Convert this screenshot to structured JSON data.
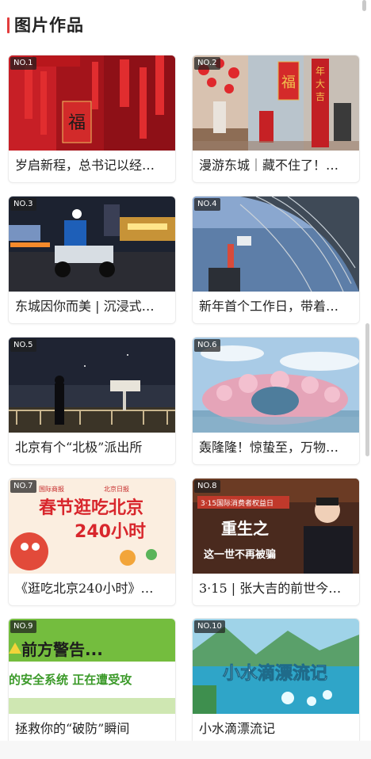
{
  "header": {
    "title": "图片作品"
  },
  "cards": [
    {
      "no": "NO.1",
      "caption": "岁启新程，总书记以经…"
    },
    {
      "no": "NO.2",
      "caption": "漫游东城｜藏不住了！…",
      "image_text": [
        "福",
        "年",
        "大",
        "吉"
      ]
    },
    {
      "no": "NO.3",
      "caption": "东城因你而美 | 沉浸式…"
    },
    {
      "no": "NO.4",
      "caption": "新年首个工作日，带着…"
    },
    {
      "no": "NO.5",
      "caption": "北京有个“北极”派出所"
    },
    {
      "no": "NO.6",
      "caption": "轰隆隆！惊蛰至，万物…"
    },
    {
      "no": "NO.7",
      "caption": "《逛吃北京240小时》…",
      "image_text": [
        "国际商报",
        "北京日报",
        "春节逛吃北京",
        "240小时"
      ]
    },
    {
      "no": "NO.8",
      "caption": "3·15 | 张大吉的前世今…",
      "image_text": [
        "3·15国际消费者权益日",
        "重生之",
        "这一世不再被骗"
      ]
    },
    {
      "no": "NO.9",
      "caption": "拯救你的“破防”瞬间",
      "image_text": [
        "前方警告...",
        "的安全系统 正在遭受攻"
      ]
    },
    {
      "no": "NO.10",
      "caption": "小水滴漂流记",
      "image_text": [
        "小水滴漂流记"
      ]
    }
  ]
}
